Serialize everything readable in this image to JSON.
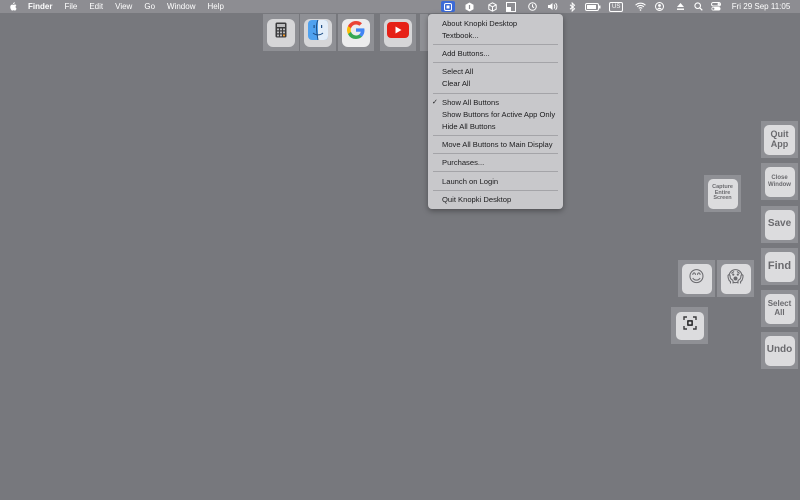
{
  "menubar": {
    "apple_icon": "apple-logo-icon",
    "items": [
      "Finder",
      "File",
      "Edit",
      "View",
      "Go",
      "Window",
      "Help"
    ],
    "input_source": "US",
    "datetime": "Fri 29 Sep  11:05"
  },
  "top_buttons": [
    {
      "name": "calculator",
      "icon": "calculator-icon"
    },
    {
      "name": "finder",
      "icon": "finder-icon"
    },
    {
      "name": "google",
      "icon": "google-icon",
      "label": "G"
    },
    {
      "name": "youtube",
      "icon": "youtube-icon"
    }
  ],
  "menu": {
    "items": [
      "About Knopki Desktop",
      "Textbook...",
      "Add Buttons...",
      "Select All",
      "Clear All",
      "Show All Buttons",
      "Show Buttons for Active App Only",
      "Hide All Buttons",
      "Move All Buttons to Main Display",
      "Purchases...",
      "Launch on Login",
      "Quit Knopki Desktop"
    ],
    "checked_item": "Show All Buttons",
    "check_mark": "✓"
  },
  "side_buttons": {
    "quit_app": "Quit App",
    "close_window": "Close Window",
    "save": "Save",
    "find": "Find",
    "select_all": "Select All",
    "undo": "Undo",
    "capture_entire_screen": "Capture Entire Screen",
    "smile_emoji": "😊",
    "scream_emoji": "😱"
  },
  "colors": {
    "desktop": "#77787d",
    "menubar": "#8d8d92",
    "menu_bg": "#c8c8cb",
    "youtube_red": "#e62117",
    "google_blue": "#4285f4",
    "knopki_accent": "#3c6ad6"
  }
}
